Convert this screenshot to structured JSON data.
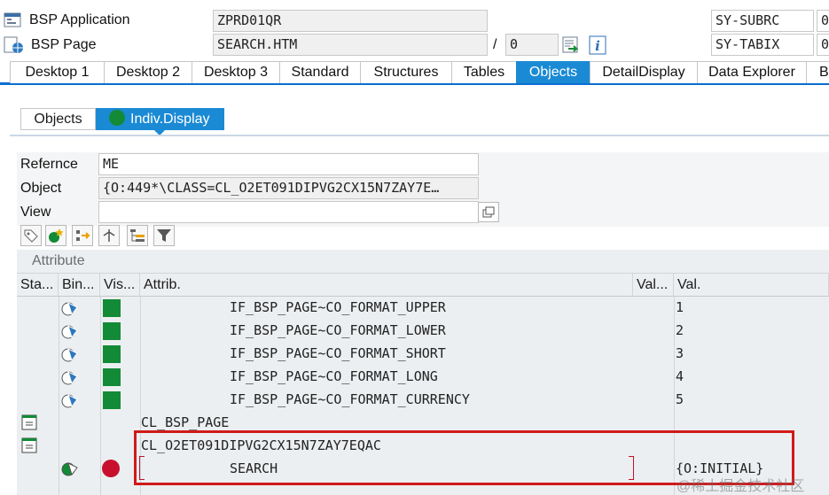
{
  "header": {
    "bsp_application_label": "BSP Application",
    "bsp_application_value": "ZPRD01QR",
    "bsp_page_label": "BSP Page",
    "bsp_page_value": "SEARCH.HTM",
    "slash": "/",
    "page_index": "0",
    "sy_subrc_label": "SY-SUBRC",
    "sy_subrc_value": "0",
    "sy_tabix_label": "SY-TABIX",
    "sy_tabix_value": "0"
  },
  "tabs": [
    "Desktop 1",
    "Desktop 2",
    "Desktop 3",
    "Standard",
    "Structures",
    "Tables",
    "Objects",
    "DetailDisplay",
    "Data Explorer",
    "Br"
  ],
  "active_tab": "Objects",
  "subtabs": {
    "objects": "Objects",
    "indiv_display": "Indiv.Display"
  },
  "form": {
    "reference_label": "Refernce",
    "reference_value": "ME",
    "object_label": "Object",
    "object_value": "{O:449*\\CLASS=CL_O2ET091DIPVG2CX15N7ZAY7E…",
    "view_label": "View",
    "view_value": ""
  },
  "toolbar_icons": [
    "tag-icon",
    "object-star-icon",
    "move-icon",
    "hierarchy-icon",
    "tree-list-icon",
    "filter-icon"
  ],
  "grid": {
    "section_title": "Attribute",
    "columns": [
      "Sta...",
      "Bin...",
      "Vis...",
      "Attrib.",
      "Val...",
      "Val."
    ],
    "rows": [
      {
        "attrib": "IF_BSP_PAGE~CO_FORMAT_UPPER",
        "value": "1"
      },
      {
        "attrib": "IF_BSP_PAGE~CO_FORMAT_LOWER",
        "value": "2"
      },
      {
        "attrib": "IF_BSP_PAGE~CO_FORMAT_SHORT",
        "value": "3"
      },
      {
        "attrib": "IF_BSP_PAGE~CO_FORMAT_LONG",
        "value": "4"
      },
      {
        "attrib": "IF_BSP_PAGE~CO_FORMAT_CURRENCY",
        "value": "5"
      },
      {
        "attrib": "CL_BSP_PAGE",
        "value": ""
      },
      {
        "attrib": "CL_O2ET091DIPVG2CX15N7ZAY7EQAC",
        "value": ""
      },
      {
        "attrib": "SEARCH",
        "value": "{O:INITIAL}"
      }
    ]
  },
  "watermark": "@稀土掘金技术社区",
  "colors": {
    "accent": "#1a8ad4",
    "highlight_box": "#d11a1a",
    "green": "#138a36",
    "red": "#c8102e"
  }
}
